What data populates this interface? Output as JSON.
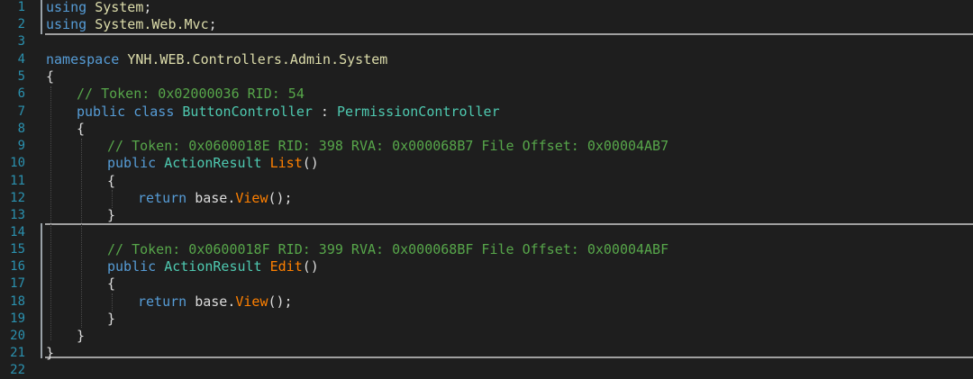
{
  "editor": {
    "line_numbers": [
      "1",
      "2",
      "3",
      "4",
      "5",
      "6",
      "7",
      "8",
      "9",
      "10",
      "11",
      "12",
      "13",
      "14",
      "15",
      "16",
      "17",
      "18",
      "19",
      "20",
      "21",
      "22"
    ],
    "lines": {
      "l1": {
        "kw": "using",
        "sp": " ",
        "ns": "System",
        "pl": ";"
      },
      "l2": {
        "kw": "using",
        "sp": " ",
        "ns": "System.Web.Mvc",
        "pl": ";"
      },
      "l4": {
        "kw": "namespace",
        "sp": " ",
        "ns": "YNH.WEB.Controllers.Admin.System"
      },
      "l5": {
        "pl": "{"
      },
      "l6": {
        "cm": "// Token: 0x02000036 RID: 54"
      },
      "l7": {
        "kw": "public class",
        "sp": " ",
        "ty": "ButtonController",
        "pl": " : ",
        "ty2": "PermissionController"
      },
      "l8": {
        "pl": "{"
      },
      "l9": {
        "cm": "// Token: 0x0600018E RID: 398 RVA: 0x000068B7 File Offset: 0x00004AB7"
      },
      "l10": {
        "kw": "public",
        "sp": " ",
        "ty": "ActionResult",
        "sp2": " ",
        "fn": "List",
        "pl": "()"
      },
      "l11": {
        "pl": "{"
      },
      "l12": {
        "kw": "return",
        "sp": " ",
        "pl": "base.",
        "fn": "View",
        "pl2": "();"
      },
      "l13": {
        "pl": "}"
      },
      "l15": {
        "cm": "// Token: 0x0600018F RID: 399 RVA: 0x000068BF File Offset: 0x00004ABF"
      },
      "l16": {
        "kw": "public",
        "sp": " ",
        "ty": "ActionResult",
        "sp2": " ",
        "fn": "Edit",
        "pl": "()"
      },
      "l17": {
        "pl": "{"
      },
      "l18": {
        "kw": "return",
        "sp": " ",
        "pl": "base.",
        "fn": "View",
        "pl2": "();"
      },
      "l19": {
        "pl": "}"
      },
      "l20": {
        "pl": "}"
      },
      "l21": {
        "pl": "}"
      }
    }
  }
}
